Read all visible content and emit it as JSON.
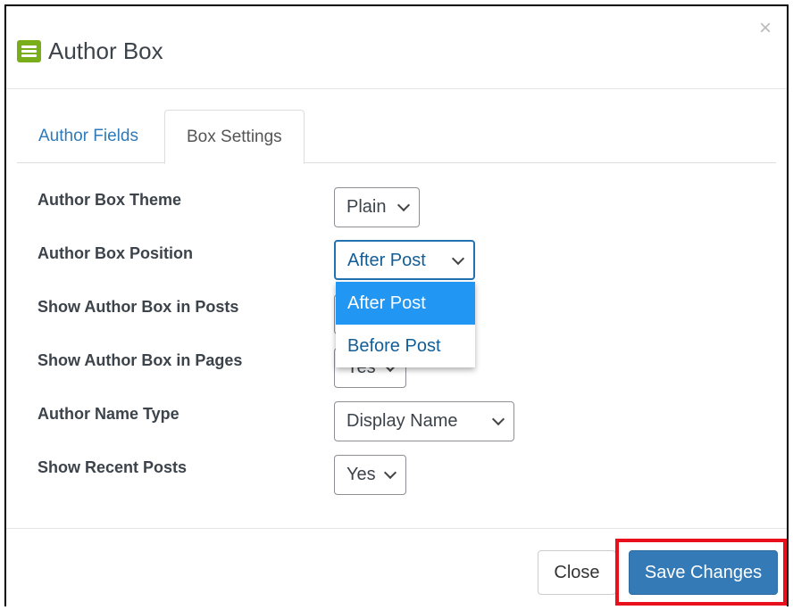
{
  "modal": {
    "title": "Author Box",
    "title_icon": "list-icon",
    "close_icon": "×"
  },
  "tabs": [
    {
      "label": "Author Fields",
      "active": false
    },
    {
      "label": "Box Settings",
      "active": true
    }
  ],
  "fields": [
    {
      "label": "Author Box Theme",
      "value": "Plain"
    },
    {
      "label": "Author Box Position",
      "value": "After Post",
      "open": true,
      "options": [
        "After Post",
        "Before Post"
      ],
      "highlighted": "After Post"
    },
    {
      "label": "Show Author Box in Posts",
      "value": ""
    },
    {
      "label": "Show Author Box in Pages",
      "value": "Yes"
    },
    {
      "label": "Author Name Type",
      "value": "Display Name"
    },
    {
      "label": "Show Recent Posts",
      "value": "Yes"
    }
  ],
  "footer": {
    "close_label": "Close",
    "save_label": "Save Changes"
  },
  "colors": {
    "accent": "#337ab7",
    "highlight_box": "#e8101c",
    "dropdown_selected": "#2196f3",
    "icon": "#7aad1a"
  }
}
